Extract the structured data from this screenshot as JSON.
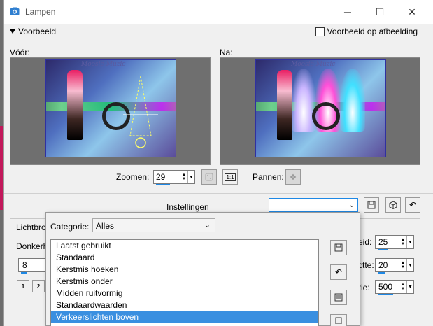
{
  "window": {
    "title": "Lampen",
    "minimize_glyph": "─",
    "maximize_glyph": "☐",
    "close_glyph": "✕"
  },
  "preview": {
    "toggle_label": "Voorbeeld",
    "on_image_label": "Voorbeeld op afbeelding",
    "before_label": "Vóór:",
    "after_label": "Na:",
    "image_caption": "Moosie Muzic"
  },
  "zoom": {
    "label": "Zoomen:",
    "value": "29",
    "pan_label": "Pannen:",
    "fit_icon": "fit-icon",
    "one_to_one_label": "1:1"
  },
  "settings": {
    "label": "Instellingen",
    "value": ""
  },
  "params": {
    "lichtbron_label": "Lichtbro",
    "donker_label": "Donkerh",
    "left_value": "8",
    "preset_1": "1",
    "preset_2": "2",
    "right_label_1": "eid:",
    "right_value_1": "25",
    "right_label_2": "ctte:",
    "right_value_2": "20",
    "right_label_3": "rie:",
    "right_value_3": "500"
  },
  "popup": {
    "category_label": "Categorie:",
    "category_value": "Alles",
    "items": [
      "Laatst gebruikt",
      "Standaard",
      "Kerstmis hoeken",
      "Kerstmis onder",
      "Midden ruitvormig",
      "Standaardwaarden",
      "Verkeerslichten boven"
    ],
    "selected_index": 6
  },
  "colors": {
    "accent": "#1e88e5",
    "selection": "#3a8fe0"
  }
}
